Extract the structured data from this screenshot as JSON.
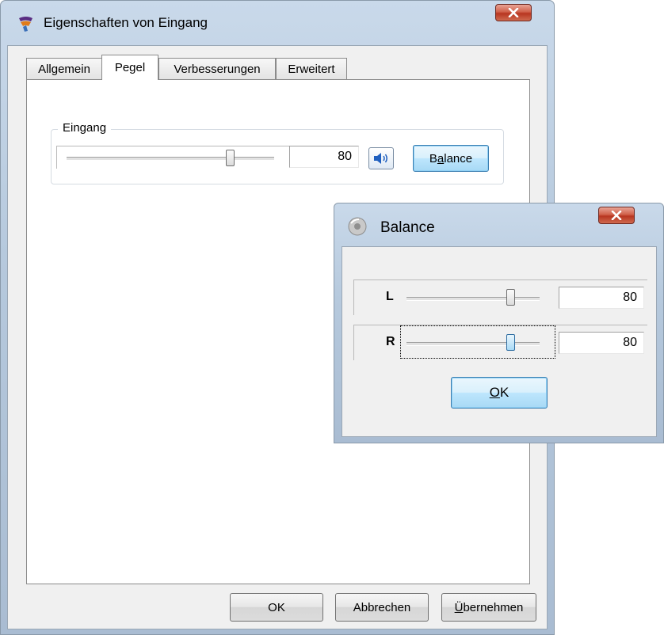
{
  "main_dialog": {
    "title": "Eigenschaften von Eingang",
    "tabs": [
      {
        "label": "Allgemein"
      },
      {
        "label": "Pegel"
      },
      {
        "label": "Verbesserungen"
      },
      {
        "label": "Erweitert"
      }
    ],
    "active_tab": "Pegel",
    "group": {
      "label": "Eingang",
      "level": 80,
      "value": "80",
      "mute_icon": "speaker-icon",
      "balance_button": {
        "pre": "B",
        "accel": "a",
        "post": "lance"
      }
    },
    "buttons": {
      "ok": "OK",
      "cancel": "Abbrechen",
      "apply": {
        "pre": "",
        "accel": "Ü",
        "post": "bernehmen"
      }
    }
  },
  "balance_dialog": {
    "title": "Balance",
    "channels": [
      {
        "label": "L",
        "level": 80,
        "value": "80"
      },
      {
        "label": "R",
        "level": 80,
        "value": "80"
      }
    ],
    "ok_button": {
      "accel": "O",
      "post": "K"
    }
  },
  "colors": {
    "window_frame": "#b6c9dd",
    "close_button": "#c8452f",
    "focus_button": "#bee6fd",
    "face": "#f0f0f0"
  }
}
